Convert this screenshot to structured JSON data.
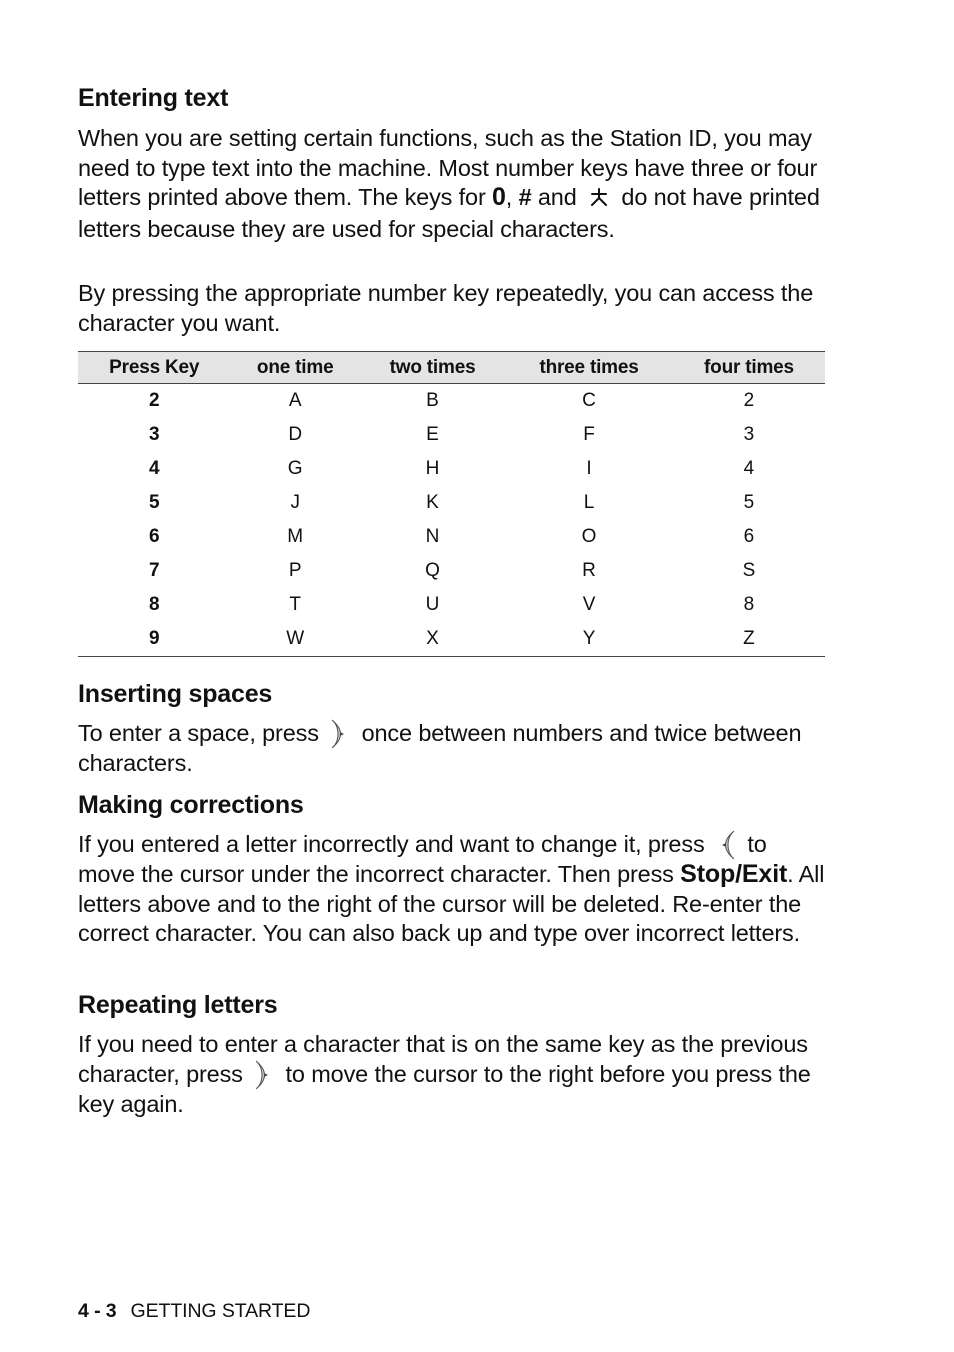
{
  "sections": {
    "entering_text": {
      "heading": "Entering text",
      "para1_part1": "When you are setting certain functions, such as the Station ID, you may need to type text into the machine. Most number keys have three or four letters printed above them. The keys for ",
      "key_zero": "0",
      "sep1": ", ",
      "key_hash": "#",
      "sep2": " and ",
      "key_star_icon": "star-key-icon",
      "para1_part2": " do not have printed letters because they are used for special characters.",
      "para2": "By pressing the appropriate number key repeatedly, you can access the character you want."
    },
    "inserting_spaces": {
      "heading": "Inserting spaces",
      "text_before": "To enter a space, press ",
      "icon": "right-arrow-key-icon",
      "text_after": " once between numbers and twice between characters."
    },
    "making_corrections": {
      "heading": "Making corrections",
      "text_before": "If you entered a letter incorrectly and want to change it, press ",
      "icon": "left-arrow-key-icon",
      "text_mid": " to move the cursor under the incorrect character. Then press ",
      "bold_key": "Stop/Exit",
      "text_after": ". All letters above and to the right of the cursor will be deleted. Re-enter the correct character. You can also back up and type over incorrect letters."
    },
    "repeating_letters": {
      "heading": "Repeating letters",
      "text_before": "If you need to enter a character that is on the same key as the previous character, press ",
      "icon": "right-arrow-key-icon",
      "text_after": " to move the cursor to the right before you press the key again."
    }
  },
  "key_table": {
    "headers": [
      "Press Key",
      "one time",
      "two times",
      "three times",
      "four times"
    ],
    "rows": [
      [
        "2",
        "A",
        "B",
        "C",
        "2"
      ],
      [
        "3",
        "D",
        "E",
        "F",
        "3"
      ],
      [
        "4",
        "G",
        "H",
        "I",
        "4"
      ],
      [
        "5",
        "J",
        "K",
        "L",
        "5"
      ],
      [
        "6",
        "M",
        "N",
        "O",
        "6"
      ],
      [
        "7",
        "P",
        "Q",
        "R",
        "S"
      ],
      [
        "8",
        "T",
        "U",
        "V",
        "8"
      ],
      [
        "9",
        "W",
        "X",
        "Y",
        "Z"
      ]
    ],
    "header_bg": "#e4e4e4"
  },
  "footer": {
    "page_number": "4 - 3",
    "chapter": "GETTING STARTED"
  }
}
